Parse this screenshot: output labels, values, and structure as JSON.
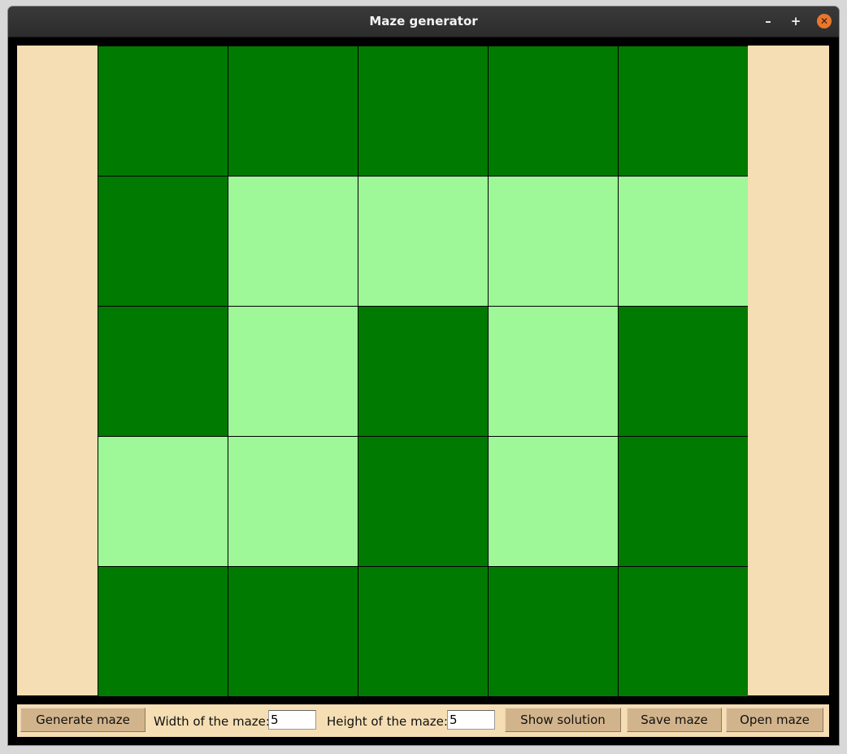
{
  "window": {
    "title": "Maze generator",
    "minimize_glyph": "–",
    "maximize_glyph": "+",
    "close_glyph": "✕"
  },
  "colors": {
    "wall": "#007a00",
    "path": "#9ef898",
    "background": "#f5deb3",
    "button": "#d2b48c"
  },
  "maze": {
    "rows": [
      [
        "wall",
        "wall",
        "wall",
        "wall",
        "wall"
      ],
      [
        "wall",
        "path",
        "path",
        "path",
        "path"
      ],
      [
        "wall",
        "path",
        "wall",
        "path",
        "wall"
      ],
      [
        "path",
        "path",
        "wall",
        "path",
        "wall"
      ],
      [
        "wall",
        "wall",
        "wall",
        "wall",
        "wall"
      ]
    ]
  },
  "toolbar": {
    "generate_label": "Generate maze",
    "width_label": "Width of the maze:",
    "width_value": "5",
    "height_label": "Height of the maze:",
    "height_value": "5",
    "solution_label": "Show solution",
    "save_label": "Save maze",
    "open_label": "Open maze"
  }
}
